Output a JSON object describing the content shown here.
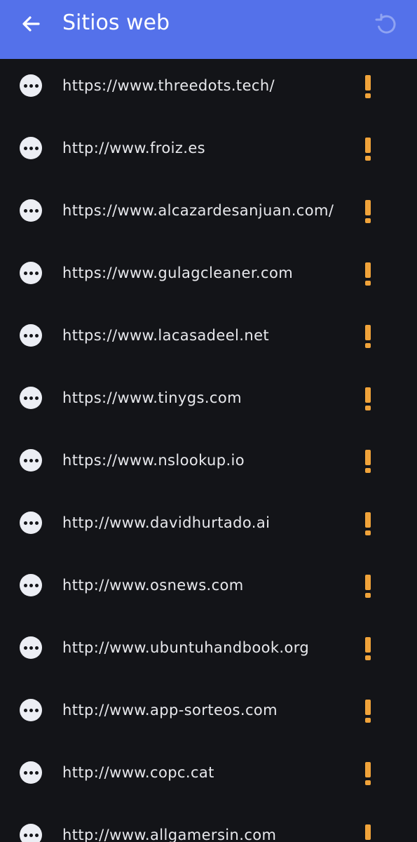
{
  "header": {
    "title": "Sitios web",
    "back_icon": "arrow-left-icon",
    "refresh_icon": "refresh-icon",
    "background": "#5471ea"
  },
  "list": {
    "item_icon": "more-horizontal-icon",
    "status_icon": "exclamation-icon",
    "warning_color": "#f0a33a",
    "items": [
      {
        "url": "https://www.threedots.tech/"
      },
      {
        "url": "http://www.froiz.es"
      },
      {
        "url": "https://www.alcazardesanjuan.com/"
      },
      {
        "url": "https://www.gulagcleaner.com"
      },
      {
        "url": "https://www.lacasadeel.net"
      },
      {
        "url": "https://www.tinygs.com"
      },
      {
        "url": "https://www.nslookup.io"
      },
      {
        "url": "http://www.davidhurtado.ai"
      },
      {
        "url": "http://www.osnews.com"
      },
      {
        "url": "http://www.ubuntuhandbook.org"
      },
      {
        "url": "http://www.app-sorteos.com"
      },
      {
        "url": "http://www.copc.cat"
      },
      {
        "url": "http://www.allgamersin.com"
      }
    ]
  }
}
